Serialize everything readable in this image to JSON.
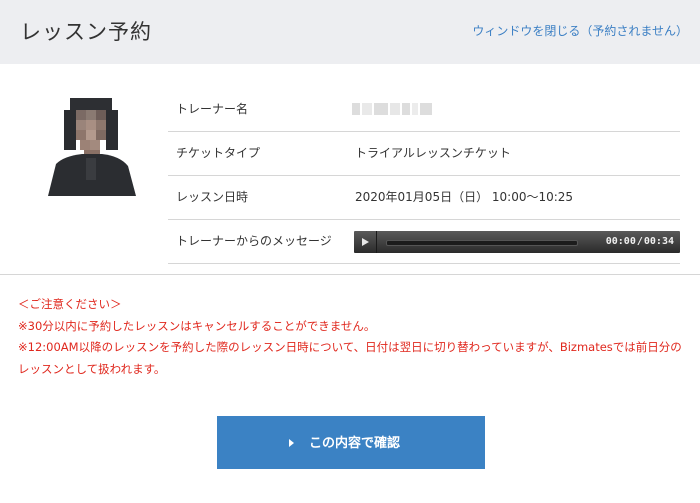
{
  "header": {
    "title": "レッスン予約",
    "close_link": "ウィンドウを閉じる（予約されません）"
  },
  "details": {
    "rows": [
      {
        "label": "トレーナー名",
        "value": ""
      },
      {
        "label": "チケットタイプ",
        "value": "トライアルレッスンチケット"
      },
      {
        "label": "レッスン日時",
        "value": "2020年01月05日（日） 10:00〜10:25"
      },
      {
        "label": "トレーナーからのメッセージ",
        "value": ""
      }
    ]
  },
  "player": {
    "current_time": "00:00",
    "separator": "/",
    "duration": "00:34",
    "progress": 0
  },
  "notice": {
    "lines": [
      "＜ご注意ください＞",
      "※30分以内に予約したレッスンはキャンセルすることができません。",
      "※12:00AM以降のレッスンを予約した際のレッスン日時について、日付は翌日に切り替わっていますが、Bizmatesでは前日分のレッスンとして扱われます。"
    ]
  },
  "confirm_button": {
    "label": "この内容で確認"
  },
  "colors": {
    "accent": "#3b82c4",
    "link": "#3b7fc4",
    "warning": "#e0281e",
    "header_bg": "#edeef1"
  }
}
